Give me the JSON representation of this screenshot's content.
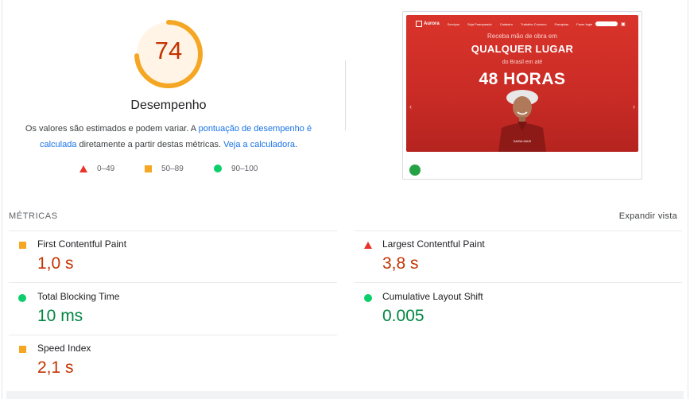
{
  "score": {
    "value": "74",
    "fraction": 0.74,
    "title": "Desempenho",
    "color": "#c33300",
    "ring_color": "#f5a623",
    "ring_bg": "#fff4e5"
  },
  "description": {
    "text_before": "Os valores são estimados e podem variar. A ",
    "link1": "pontuação de desempenho é calculada",
    "text_middle": " diretamente a partir destas métricas. ",
    "link2": "Veja a calculadora",
    "text_after": "."
  },
  "legend": [
    {
      "icon": "triangle-icon",
      "label": "0–49",
      "color": "#e8332b"
    },
    {
      "icon": "square-icon",
      "label": "50–89",
      "color": "#f5a623"
    },
    {
      "icon": "circle-icon",
      "label": "90–100",
      "color": "#0cce6b"
    }
  ],
  "screenshot": {
    "nav": {
      "logo": "Aurora",
      "items": [
        "Serviços",
        "Seja Franqueado",
        "Cadastro",
        "Trabalhe Conosco",
        "Franquias"
      ],
      "login": "Fazer login"
    },
    "line1": "Receba mão de obra em",
    "line2": "QUALQUER LUGAR",
    "line3": "do Brasil em até",
    "line4": "48 HORAS",
    "caption": "SAIBA MAIS",
    "bg_color": "#d9342b"
  },
  "metrics_header": "MÉTRICAS",
  "expand_label": "Expandir vista",
  "metrics": [
    {
      "label": "First Contentful Paint",
      "value": "1,0 s",
      "status": "average",
      "icon": "square-icon"
    },
    {
      "label": "Largest Contentful Paint",
      "value": "3,8 s",
      "status": "fail",
      "icon": "triangle-icon"
    },
    {
      "label": "Total Blocking Time",
      "value": "10 ms",
      "status": "pass",
      "icon": "circle-icon"
    },
    {
      "label": "Cumulative Layout Shift",
      "value": "0.005",
      "status": "pass",
      "icon": "circle-icon"
    },
    {
      "label": "Speed Index",
      "value": "2,1 s",
      "status": "average",
      "icon": "square-icon"
    }
  ]
}
